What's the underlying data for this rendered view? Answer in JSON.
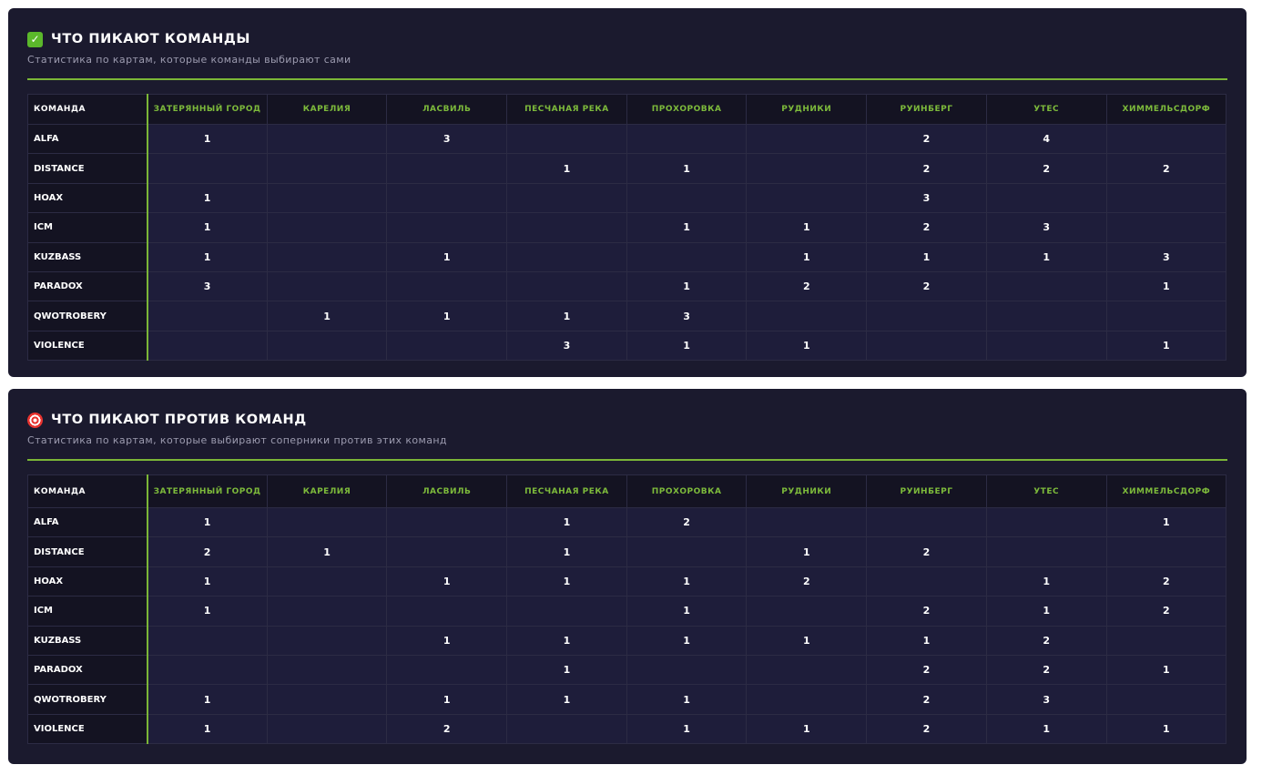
{
  "maps": [
    "ЗАТЕРЯННЫЙ ГОРОД",
    "КАРЕЛИЯ",
    "ЛАСВИЛЬ",
    "ПЕСЧАНАЯ РЕКА",
    "ПРОХОРОВКА",
    "РУДНИКИ",
    "РУИНБЕРГ",
    "УТЕС",
    "ХИММЕЛЬСДОРФ"
  ],
  "team_header": "КОМАНДА",
  "sections": [
    {
      "icon": "check-mark-icon",
      "title": "ЧТО ПИКАЮТ КОМАНДЫ",
      "subtitle": "Статистика по картам, которые команды выбирают сами",
      "rows": [
        {
          "team": "ALFA",
          "values": [
            "1",
            "",
            "3",
            "",
            "",
            "",
            "2",
            "4",
            ""
          ]
        },
        {
          "team": "DISTANCE",
          "values": [
            "",
            "",
            "",
            "1",
            "1",
            "",
            "2",
            "2",
            "2"
          ]
        },
        {
          "team": "HOAX",
          "values": [
            "1",
            "",
            "",
            "",
            "",
            "",
            "3",
            "",
            ""
          ]
        },
        {
          "team": "ICM",
          "values": [
            "1",
            "",
            "",
            "",
            "1",
            "1",
            "2",
            "3",
            ""
          ]
        },
        {
          "team": "KUZBASS",
          "values": [
            "1",
            "",
            "1",
            "",
            "",
            "1",
            "1",
            "1",
            "3"
          ]
        },
        {
          "team": "PARADOX",
          "values": [
            "3",
            "",
            "",
            "",
            "1",
            "2",
            "2",
            "",
            "1"
          ]
        },
        {
          "team": "QWOTROBERY",
          "values": [
            "",
            "1",
            "1",
            "1",
            "3",
            "",
            "",
            "",
            ""
          ]
        },
        {
          "team": "VIOLENCE",
          "values": [
            "",
            "",
            "",
            "3",
            "1",
            "1",
            "",
            "",
            "1"
          ]
        }
      ]
    },
    {
      "icon": "target-icon",
      "title": "ЧТО ПИКАЮТ ПРОТИВ КОМАНД",
      "subtitle": "Статистика по картам, которые выбирают соперники против этих команд",
      "rows": [
        {
          "team": "ALFA",
          "values": [
            "1",
            "",
            "",
            "1",
            "2",
            "",
            "",
            "",
            "1"
          ]
        },
        {
          "team": "DISTANCE",
          "values": [
            "2",
            "1",
            "",
            "1",
            "",
            "1",
            "2",
            "",
            ""
          ]
        },
        {
          "team": "HOAX",
          "values": [
            "1",
            "",
            "1",
            "1",
            "1",
            "2",
            "",
            "1",
            "2"
          ]
        },
        {
          "team": "ICM",
          "values": [
            "1",
            "",
            "",
            "",
            "1",
            "",
            "2",
            "1",
            "2"
          ]
        },
        {
          "team": "KUZBASS",
          "values": [
            "",
            "",
            "1",
            "1",
            "1",
            "1",
            "1",
            "2",
            ""
          ]
        },
        {
          "team": "PARADOX",
          "values": [
            "",
            "",
            "",
            "1",
            "",
            "",
            "2",
            "2",
            "1"
          ]
        },
        {
          "team": "QWOTROBERY",
          "values": [
            "1",
            "",
            "1",
            "1",
            "1",
            "",
            "2",
            "3",
            ""
          ]
        },
        {
          "team": "VIOLENCE",
          "values": [
            "1",
            "",
            "2",
            "",
            "1",
            "1",
            "2",
            "1",
            "1"
          ]
        }
      ]
    }
  ]
}
